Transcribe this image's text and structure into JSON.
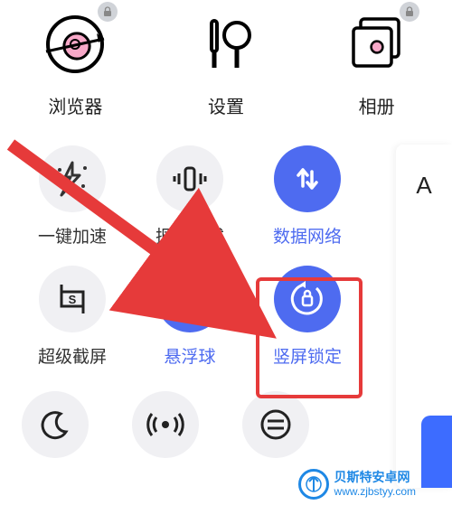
{
  "apps": {
    "browser": {
      "label": "浏览器",
      "locked": true
    },
    "settings": {
      "label": "设置",
      "locked": false
    },
    "gallery": {
      "label": "相册",
      "locked": true
    }
  },
  "tiles": {
    "boost": {
      "label": "一键加速",
      "active": false
    },
    "vibration": {
      "label": "振动模式",
      "active": false
    },
    "data": {
      "label": "数据网络",
      "active": true
    },
    "screenshot": {
      "label": "超级截屏",
      "active": false
    },
    "floatball": {
      "label": "悬浮球",
      "active": true
    },
    "portrait_lock": {
      "label": "竖屏锁定",
      "active": true
    }
  },
  "side": {
    "letter": "A"
  },
  "watermark": {
    "line1": "贝斯特安卓网",
    "line2": "www.zjbstyy.com"
  },
  "colors": {
    "active": "#4e6bf0",
    "highlight": "#e63a3a"
  }
}
